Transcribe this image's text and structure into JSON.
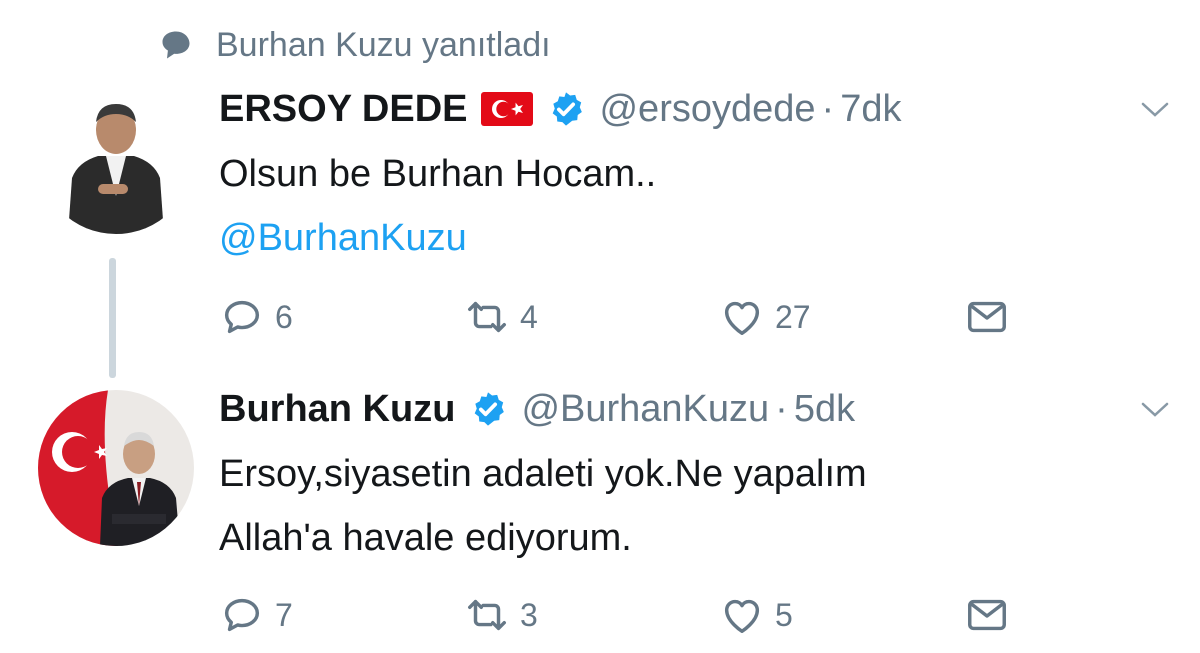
{
  "reply_context": {
    "text": "Burhan Kuzu yanıtladı"
  },
  "tweets": [
    {
      "display_name": "ERSOY DEDE",
      "handle": "@ersoydede",
      "separator": "·",
      "time": "7dk",
      "text_line1": "Olsun be Burhan Hocam..",
      "mention": "@BurhanKuzu",
      "replies": "6",
      "retweets": "4",
      "likes": "27"
    },
    {
      "display_name": "Burhan Kuzu",
      "handle": "@BurhanKuzu",
      "separator": "·",
      "time": "5dk",
      "text_line1": "Ersoy,siyasetin adaleti yok.Ne yapalım",
      "text_line2": "Allah'a havale ediyorum.",
      "replies": "7",
      "retweets": "3",
      "likes": "5"
    }
  ],
  "icons": [
    "speech-bubble-icon",
    "flag-turkey-icon",
    "verified-badge-icon",
    "chevron-down-icon",
    "reply-icon",
    "retweet-icon",
    "like-icon",
    "direct-message-icon"
  ],
  "colors": {
    "link": "#1da1f2",
    "muted": "#657786",
    "text": "#14171a",
    "thread_line": "#ccd6dd",
    "verified": "#1da1f2",
    "flag_red": "#e30a17"
  }
}
